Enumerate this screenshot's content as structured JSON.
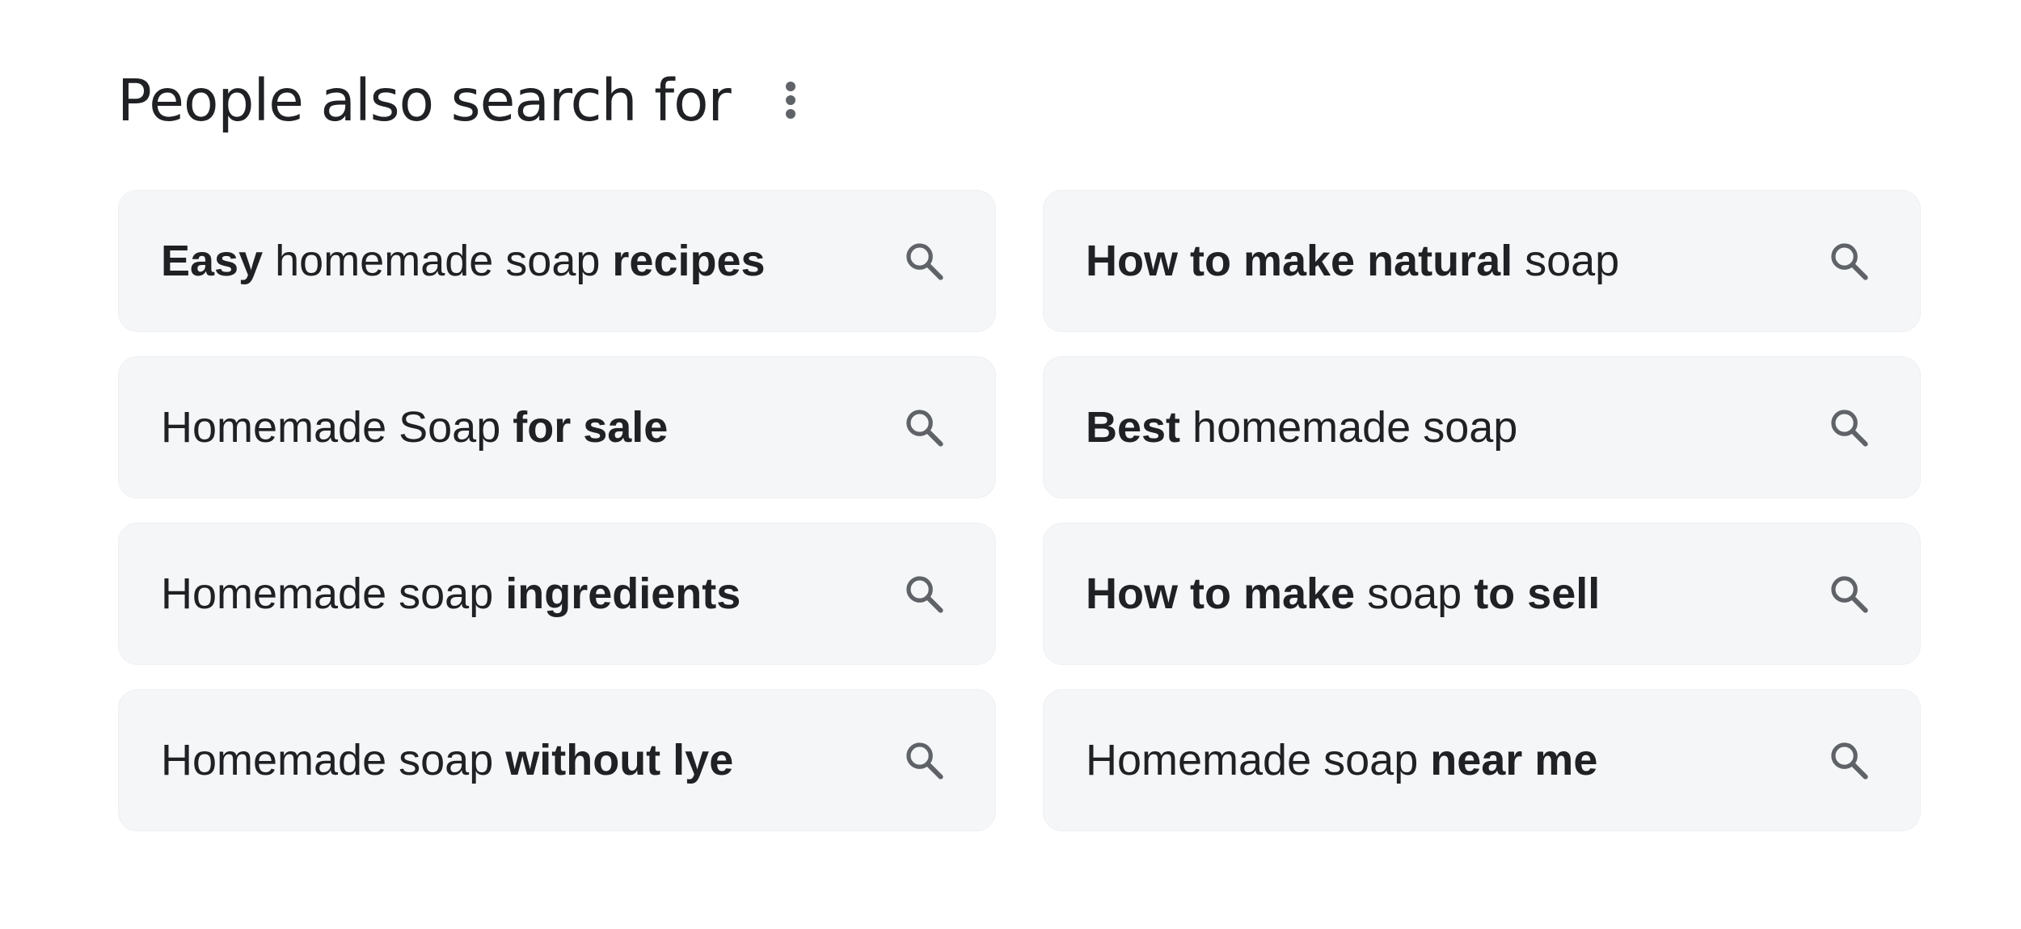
{
  "header": {
    "title": "People also search for",
    "more_icon": "more-vert-icon"
  },
  "colors": {
    "chip_background": "#f5f6f8",
    "text": "#202124",
    "icon": "#5f6368"
  },
  "suggestions": [
    {
      "segments": [
        {
          "text": "Easy",
          "bold": true
        },
        {
          "text": " homemade soap ",
          "bold": false
        },
        {
          "text": "recipes",
          "bold": true
        }
      ],
      "icon": "search-icon"
    },
    {
      "segments": [
        {
          "text": "How to make natural",
          "bold": true
        },
        {
          "text": " soap",
          "bold": false
        }
      ],
      "icon": "search-icon"
    },
    {
      "segments": [
        {
          "text": "Homemade Soap ",
          "bold": false
        },
        {
          "text": "for sale",
          "bold": true
        }
      ],
      "icon": "search-icon"
    },
    {
      "segments": [
        {
          "text": "Best",
          "bold": true
        },
        {
          "text": " homemade soap",
          "bold": false
        }
      ],
      "icon": "search-icon"
    },
    {
      "segments": [
        {
          "text": "Homemade soap ",
          "bold": false
        },
        {
          "text": "ingredients",
          "bold": true
        }
      ],
      "icon": "search-icon"
    },
    {
      "segments": [
        {
          "text": "How to make",
          "bold": true
        },
        {
          "text": " soap ",
          "bold": false
        },
        {
          "text": "to sell",
          "bold": true
        }
      ],
      "icon": "search-icon"
    },
    {
      "segments": [
        {
          "text": "Homemade soap ",
          "bold": false
        },
        {
          "text": "without lye",
          "bold": true
        }
      ],
      "icon": "search-icon"
    },
    {
      "segments": [
        {
          "text": "Homemade soap ",
          "bold": false
        },
        {
          "text": "near me",
          "bold": true
        }
      ],
      "icon": "search-icon"
    }
  ]
}
